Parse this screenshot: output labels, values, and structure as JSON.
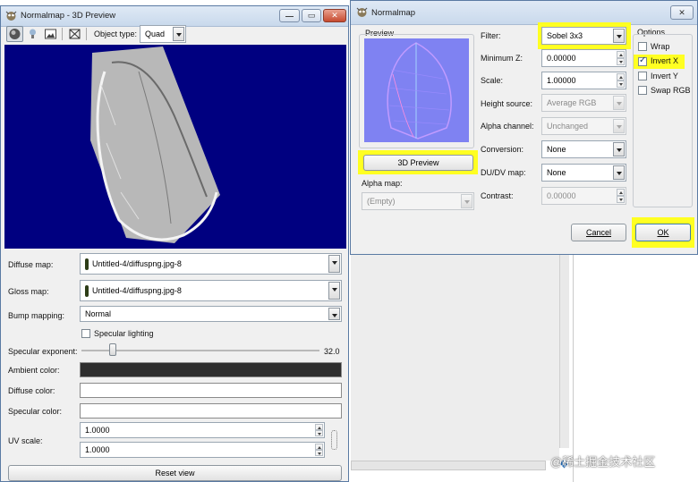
{
  "left_window": {
    "title": "Normalmap - 3D Preview",
    "toolbar": {
      "object_type_label": "Object type:",
      "object_type_value": "Quad"
    },
    "preview": {
      "background_color": "#000080",
      "object_color": "#b8b8b8"
    },
    "diffuse_map": {
      "label": "Diffuse map:",
      "value": "Untitled-4/diffuspng.jpg-8"
    },
    "gloss_map": {
      "label": "Gloss map:",
      "value": "Untitled-4/diffuspng.jpg-8"
    },
    "bump_mapping": {
      "label": "Bump mapping:",
      "value": "Normal"
    },
    "specular_lighting": {
      "label": "Specular lighting",
      "checked": false
    },
    "specular_exponent": {
      "label": "Specular exponent:",
      "value": "32.0"
    },
    "ambient_color": {
      "label": "Ambient color:",
      "color": "#2e2e2e"
    },
    "diffuse_color": {
      "label": "Diffuse color:",
      "color": "#ffffff"
    },
    "specular_color": {
      "label": "Specular color:",
      "color": "#ffffff"
    },
    "uv_scale": {
      "label": "UV scale:",
      "u": "1.0000",
      "v": "1.0000"
    },
    "reset_view_label": "Reset view"
  },
  "right_window": {
    "title": "Normalmap",
    "preview_label": "Preview",
    "preview_button_label": "3D Preview",
    "alpha_map": {
      "label": "Alpha map:",
      "value": "(Empty)"
    },
    "filter": {
      "label": "Filter:",
      "value": "Sobel 3x3"
    },
    "minimum_z": {
      "label": "Minimum Z:",
      "value": "0.00000"
    },
    "scale": {
      "label": "Scale:",
      "value": "1.00000"
    },
    "height_source": {
      "label": "Height source:",
      "value": "Average RGB"
    },
    "alpha_channel": {
      "label": "Alpha channel:",
      "value": "Unchanged"
    },
    "conversion": {
      "label": "Conversion:",
      "value": "None"
    },
    "dudv_map": {
      "label": "DU/DV map:",
      "value": "None"
    },
    "contrast": {
      "label": "Contrast:",
      "value": "0.00000"
    },
    "options": {
      "label": "Options",
      "items": [
        {
          "label": "Wrap",
          "checked": false
        },
        {
          "label": "Invert X",
          "checked": true
        },
        {
          "label": "Invert Y",
          "checked": false
        },
        {
          "label": "Swap RGB",
          "checked": false
        }
      ]
    },
    "cancel_label": "Cancel",
    "ok_label": "OK"
  },
  "highlight_color": "#ffff22",
  "watermark": "@稀土掘金技术社区"
}
